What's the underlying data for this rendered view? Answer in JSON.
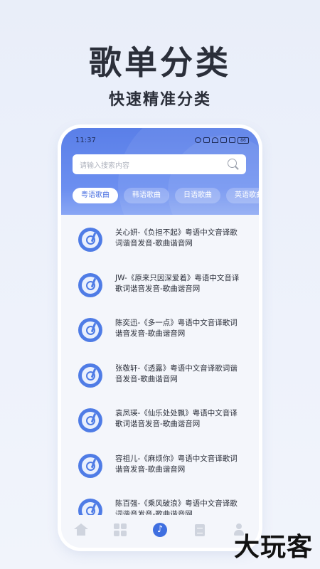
{
  "hero": {
    "title": "歌单分类",
    "subtitle": "快速精准分类"
  },
  "status_bar": {
    "time": "11:37",
    "battery": "86"
  },
  "search": {
    "placeholder": "请输入搜索内容"
  },
  "tabs": [
    {
      "label": "粤语歌曲",
      "active": true
    },
    {
      "label": "韩语歌曲",
      "active": false
    },
    {
      "label": "日语歌曲",
      "active": false
    },
    {
      "label": "英语歌曲",
      "active": false
    }
  ],
  "songs": [
    {
      "text": "关心妍-《负担不起》粤语中文音译歌词谐音发音-歌曲谐音网"
    },
    {
      "text": "JW-《原来只因深爱着》粤语中文音译歌词谐音发音-歌曲谐音网"
    },
    {
      "text": "陈奕迅-《多一点》粤语中文音译歌词谐音发音-歌曲谐音网"
    },
    {
      "text": "张敬轩-《透露》粤语中文音译歌词谐音发音-歌曲谐音网"
    },
    {
      "text": "袁凤瑛-《仙乐处处飘》粤语中文音译歌词谐音发音-歌曲谐音网"
    },
    {
      "text": "容祖儿-《麻烦你》粤语中文音译歌词谐音发音-歌曲谐音网"
    },
    {
      "text": "陈百强-《乘风破浪》粤语中文音译歌词谐音发音-歌曲谐音网"
    }
  ],
  "tabbar": {
    "icons": [
      "home-icon",
      "grid-icon",
      "music-icon",
      "document-icon",
      "user-icon"
    ],
    "active": "music-icon",
    "accent_color": "#3f6fe0"
  },
  "watermark": "大玩客",
  "colors": {
    "header_blue": "#5a7fe8",
    "accent": "#4f7ce6"
  }
}
